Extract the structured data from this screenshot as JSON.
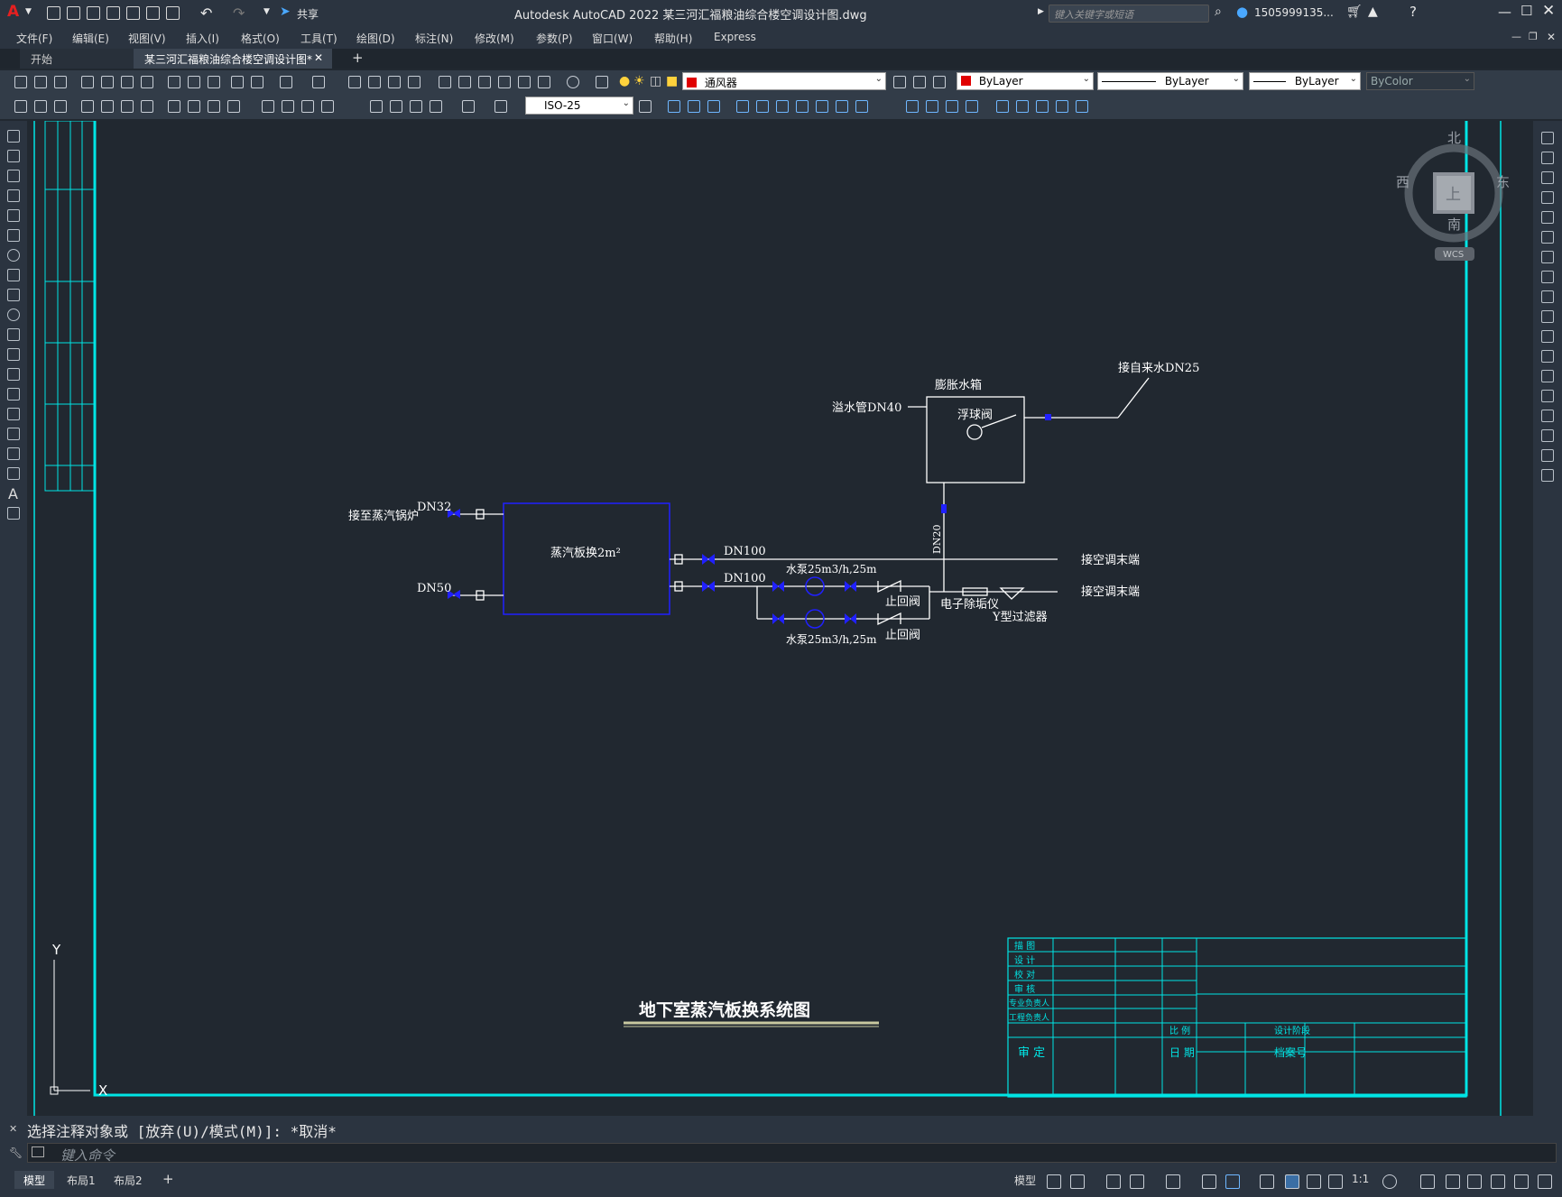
{
  "titlebar": {
    "app_letter": "A",
    "share_label": "共享",
    "title": "Autodesk AutoCAD 2022    某三河汇福粮油综合楼空调设计图.dwg",
    "search_placeholder": "键入关键字或短语",
    "user": "1505999135..."
  },
  "menu": [
    "文件(F)",
    "编辑(E)",
    "视图(V)",
    "插入(I)",
    "格式(O)",
    "工具(T)",
    "绘图(D)",
    "标注(N)",
    "修改(M)",
    "参数(P)",
    "窗口(W)",
    "帮助(H)",
    "Express"
  ],
  "tabs": {
    "start": "开始",
    "document": "某三河汇福粮油综合楼空调设计图*",
    "add": "+"
  },
  "toolbar": {
    "layer": "通风器",
    "color": "ByLayer",
    "linetype": "ByLayer",
    "lineweight": "ByLayer",
    "plotstyle": "ByColor",
    "dimstyle": "ISO-25"
  },
  "viewcube": {
    "north": "北",
    "south": "南",
    "east": "东",
    "west": "西",
    "top": "上",
    "wcs": "WCS"
  },
  "drawing": {
    "title": "地下室蒸汽板换系统图",
    "expansion_tank": "膨胀水箱",
    "float_valve": "浮球阀",
    "overflow": "溢水管DN40",
    "makeup": "接自来水DN25",
    "dn20": "DN20",
    "heat_exchanger": "蒸汽板换2m²",
    "to_boiler": "接至蒸汽锅炉",
    "dn32": "DN32",
    "dn50": "DN50",
    "dn100_a": "DN100",
    "dn100_b": "DN100",
    "pump_a": "水泵25m3/h,25m",
    "pump_b": "水泵25m3/h,25m",
    "check_valve_a": "止回阀",
    "check_valve_b": "止回阀",
    "descaler": "电子除垢仪",
    "y_filter": "Y型过滤器",
    "to_terminal_a": "接空调末端",
    "to_terminal_b": "接空调末端"
  },
  "titleblock": {
    "rows": [
      "描 图",
      "设 计",
      "校 对",
      "审 核",
      "专业负责人",
      "工程负责人"
    ],
    "approve": "审 定",
    "scale": "比 例",
    "date": "日 期",
    "stage": "设计阶段",
    "archive": "档案号"
  },
  "axes": {
    "x": "X",
    "y": "Y"
  },
  "command": {
    "history": "选择注释对象或 [放弃(U)/模式(M)]: *取消*",
    "placeholder": "键入命令"
  },
  "status": {
    "model_tab": "模型",
    "layout1": "布局1",
    "layout2": "布局2",
    "add": "+",
    "model_btn": "模型",
    "scale": "1:1"
  },
  "colors": {
    "frame": "#00e5e5",
    "diagram": "#ffffff",
    "equipment": "#1a1aff",
    "background": "#212830"
  }
}
